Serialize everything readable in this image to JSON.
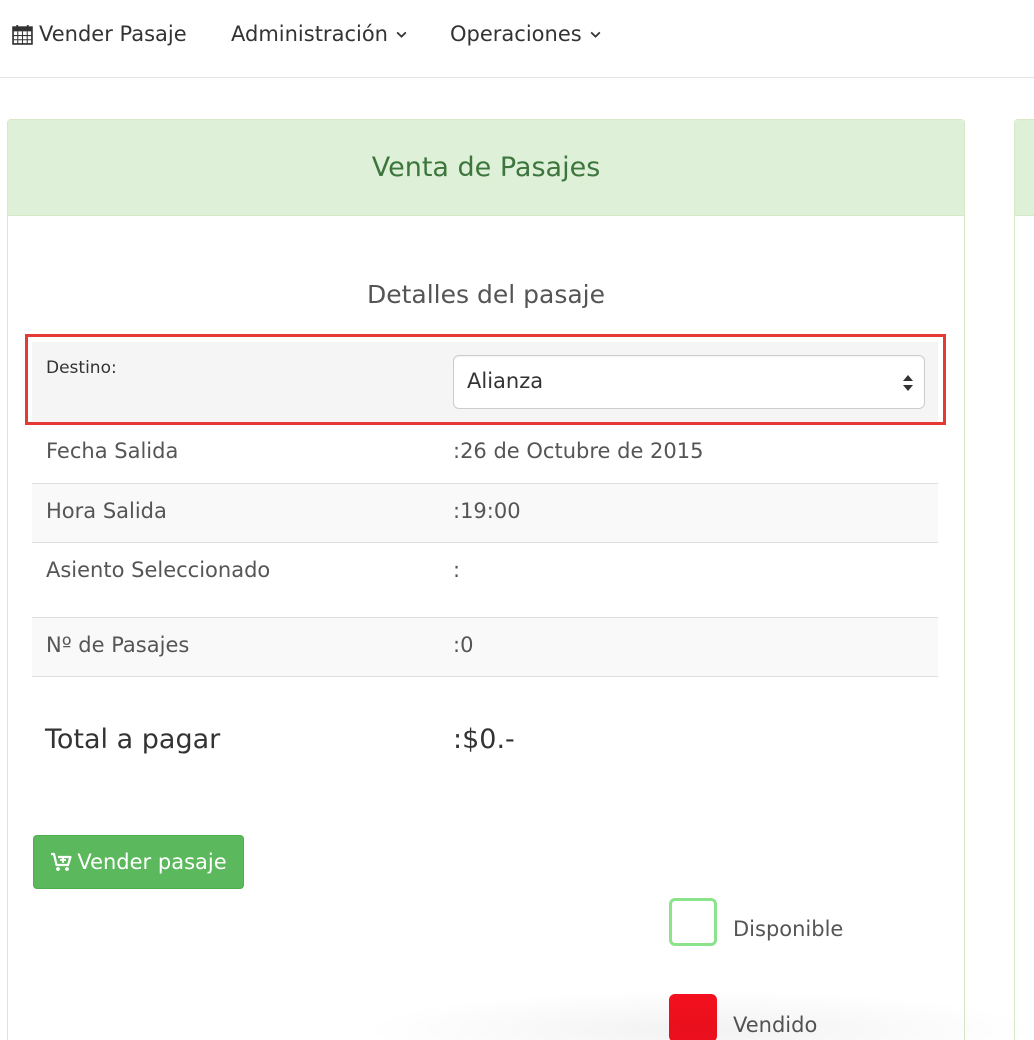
{
  "navbar": {
    "items": [
      {
        "label": "Vender Pasaje",
        "icon": "calendar-icon"
      },
      {
        "label": "Administración",
        "icon": "chevron-down-icon"
      },
      {
        "label": "Operaciones",
        "icon": "chevron-down-icon"
      }
    ]
  },
  "panel": {
    "title": "Venta de Pasajes",
    "subtitle": "Detalles del pasaje",
    "destino": {
      "label": "Destino:",
      "selected": "Alianza"
    },
    "rows": [
      {
        "label": "Fecha Salida",
        "value": ":26 de Octubre de 2015"
      },
      {
        "label": "Hora Salida",
        "value": ":19:00"
      },
      {
        "label": "Asiento Seleccionado",
        "value": ":"
      },
      {
        "label": "Nº de Pasajes",
        "value": ":0"
      }
    ],
    "total": {
      "label": "Total a pagar",
      "value": ":$0.-"
    },
    "sell_button": "Vender pasaje"
  },
  "legend": [
    {
      "label": "Disponible",
      "color": "#8be38b"
    },
    {
      "label": "Vendido",
      "color": "#f5101e"
    }
  ],
  "colors": {
    "panel_heading_bg": "#dff0d8",
    "panel_title": "#3c763d",
    "button_green": "#5cb85c",
    "highlight": "#e53935"
  }
}
